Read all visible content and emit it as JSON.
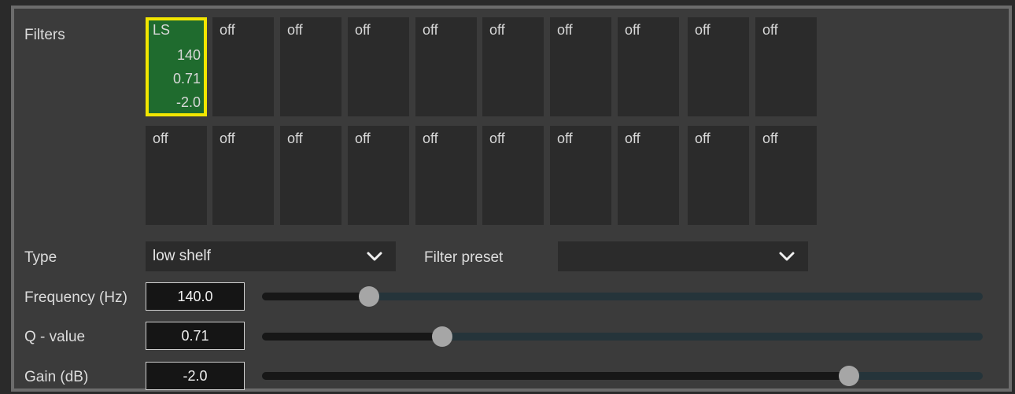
{
  "filters": {
    "label": "Filters",
    "active": {
      "type": "LS",
      "freq": "140",
      "q": "0.71",
      "gain": "-2.0"
    },
    "off_label": "off"
  },
  "type_row": {
    "label": "Type",
    "selected": "low shelf",
    "preset_label": "Filter preset",
    "preset_selected": ""
  },
  "params": {
    "frequency": {
      "label": "Frequency (Hz)",
      "value": "140.0",
      "slider_fraction": 0.148
    },
    "q": {
      "label": "Q - value",
      "value": "0.71",
      "slider_fraction": 0.25
    },
    "gain": {
      "label": "Gain (dB)",
      "value": "-2.0",
      "slider_fraction": 0.814
    }
  },
  "colors": {
    "active_cell": "#1f6b2e",
    "active_border": "#f2e600",
    "panel": "#3b3b3b",
    "cell": "#2b2b2b"
  },
  "icons": {
    "dropdown": "chevron-down-icon"
  }
}
